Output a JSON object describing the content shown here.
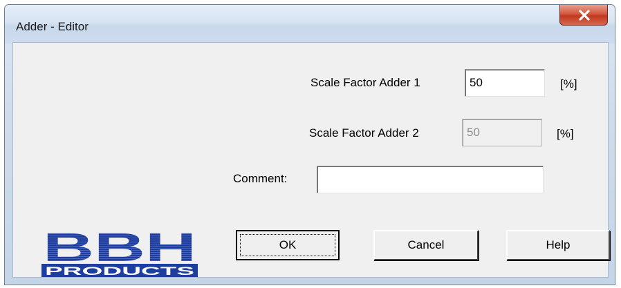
{
  "window": {
    "title": "Adder - Editor"
  },
  "titlebar": {
    "close_icon": "close-icon"
  },
  "form": {
    "scale1": {
      "label": "Scale Factor Adder 1",
      "value": "50",
      "unit": "[%]"
    },
    "scale2": {
      "label": "Scale Factor Adder 2",
      "value": "50",
      "unit": "[%]",
      "disabled": true
    },
    "comment": {
      "label": "Comment:",
      "value": ""
    }
  },
  "buttons": {
    "ok": "OK",
    "cancel": "Cancel",
    "help": "Help"
  },
  "logo": {
    "line1": "BBH",
    "line2": "PRODUCTS",
    "color": "#1d3e9e"
  }
}
